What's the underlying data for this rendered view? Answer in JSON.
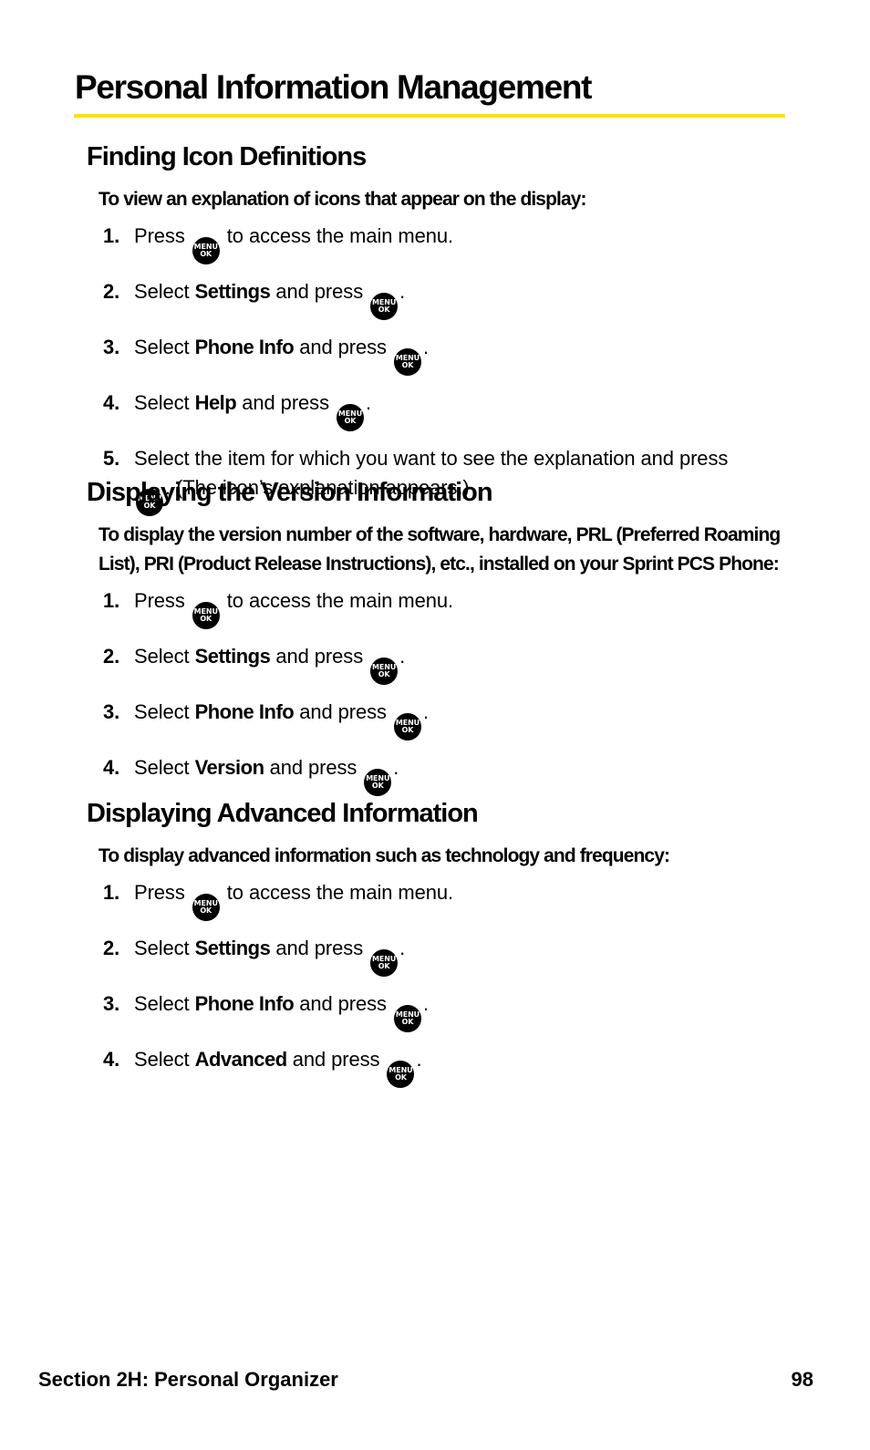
{
  "page": {
    "title": "Personal Information Management",
    "accent_color": "#ffe100"
  },
  "icons": {
    "menu_ok": {
      "name": "menu-ok-key-icon",
      "line1": "MENU",
      "line2": "OK"
    }
  },
  "sections": [
    {
      "heading": "Finding Icon Definitions",
      "intro": "To view an explanation of icons that appear on the display:",
      "steps": [
        {
          "num": "1.",
          "pre": "Press",
          "bold": "",
          "post": "to access the main menu.",
          "icon_after_pre": true
        },
        {
          "num": "2.",
          "pre": "Select",
          "bold": "Settings",
          "post": "and press",
          "end": "."
        },
        {
          "num": "3.",
          "pre": "Select",
          "bold": "Phone Info",
          "post": "and press",
          "end": "."
        },
        {
          "num": "4.",
          "pre": "Select",
          "bold": "Help",
          "post": "and press",
          "end": "."
        },
        {
          "num": "5.",
          "pre": "Select the item for which you want to see the explanation and press",
          "end": ". (The icon’s explanation appears.)"
        }
      ]
    },
    {
      "heading": "Displaying the Version Information",
      "intro": "To display the version number of the software, hardware, PRL (Preferred Roaming List), PRI (Product Release Instructions), etc., installed on your Sprint PCS Phone:",
      "steps": [
        {
          "num": "1.",
          "pre": "Press",
          "post": "to access the main menu."
        },
        {
          "num": "2.",
          "pre": "Select",
          "bold": "Settings",
          "post": "and press",
          "end": "."
        },
        {
          "num": "3.",
          "pre": "Select",
          "bold": "Phone Info",
          "post": "and press",
          "end": "."
        },
        {
          "num": "4.",
          "pre": "Select",
          "bold": "Version",
          "post": "and press",
          "end": "."
        }
      ]
    },
    {
      "heading": "Displaying Advanced Information",
      "intro": "To display advanced information such as technology and frequency:",
      "steps": [
        {
          "num": "1.",
          "pre": "Press",
          "post": "to access the main menu."
        },
        {
          "num": "2.",
          "pre": "Select",
          "bold": "Settings",
          "post": "and press",
          "end": "."
        },
        {
          "num": "3.",
          "pre": "Select",
          "bold": "Phone Info",
          "post": "and press",
          "end": "."
        },
        {
          "num": "4.",
          "pre": "Select",
          "bold": "Advanced",
          "post": "and press",
          "end": "."
        }
      ]
    }
  ],
  "footer": {
    "section_label": "Section 2H: Personal Organizer",
    "page_number": "98"
  }
}
